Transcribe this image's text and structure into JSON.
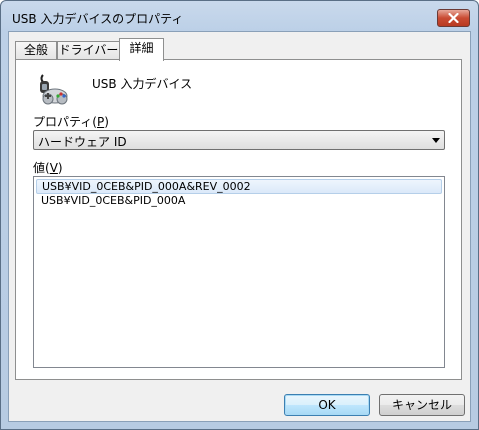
{
  "window": {
    "title": "USB 入力デバイスのプロパティ"
  },
  "tabs": [
    {
      "label": "全般"
    },
    {
      "label": "ドライバー"
    },
    {
      "label": "詳細",
      "active": true
    }
  ],
  "device": {
    "name": "USB 入力デバイス",
    "icon": "game-controller-icon"
  },
  "property": {
    "label": "プロパティ",
    "accel": "P",
    "selected": "ハードウェア ID"
  },
  "values": {
    "label": "値",
    "accel": "V",
    "items": [
      "USB¥VID_0CEB&PID_000A&REV_0002",
      "USB¥VID_0CEB&PID_000A"
    ],
    "selected_index": 0
  },
  "buttons": {
    "ok": "OK",
    "cancel": "キャンセル"
  },
  "colors": {
    "titlebar": "#bcd0e7",
    "close_button": "#c94b33",
    "selection": "#dbe9f9"
  }
}
